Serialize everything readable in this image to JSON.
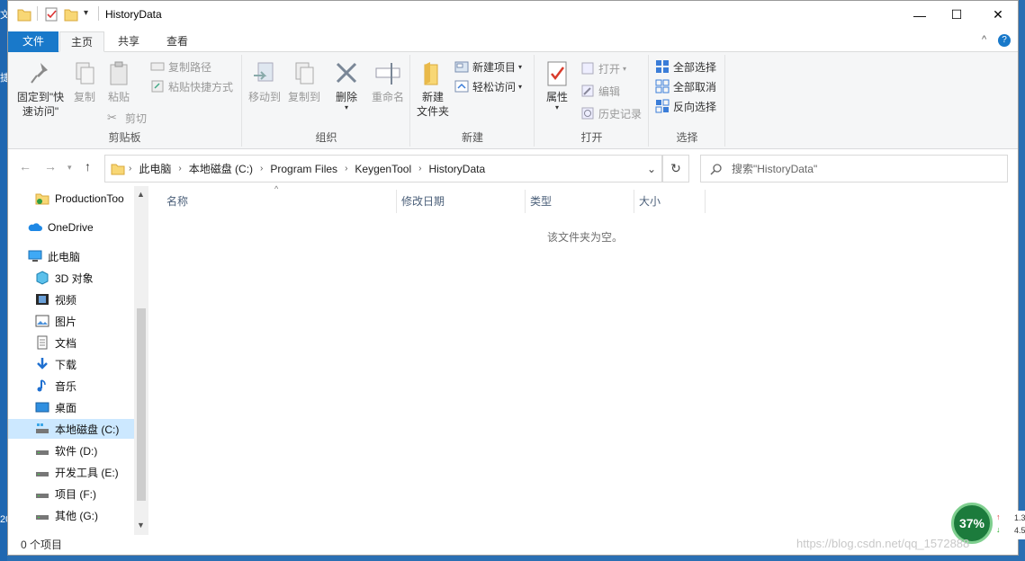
{
  "window": {
    "title": "HistoryData",
    "minimize": "—",
    "maximize": "☐",
    "close": "✕"
  },
  "desktop": {
    "left_char_top": "文",
    "left_char_mid": "捷",
    "left_char_low": "20"
  },
  "ribbon_tabs": [
    {
      "label": "文件"
    },
    {
      "label": "主页"
    },
    {
      "label": "共享"
    },
    {
      "label": "查看"
    }
  ],
  "tabs_right": {
    "collapse": "^",
    "help": "?"
  },
  "clipboard": {
    "label": "剪贴板",
    "pin": "固定到\"快速访问\"",
    "pin_line1": "固定到\"快",
    "pin_line2": "速访问\"",
    "copy": "复制",
    "paste": "粘贴",
    "copy_path": "复制路径",
    "paste_shortcut": "粘贴快捷方式",
    "cut": "剪切"
  },
  "organize": {
    "label": "组织",
    "move_to": "移动到",
    "copy_to": "复制到",
    "delete": "删除",
    "rename": "重命名"
  },
  "new_group": {
    "label": "新建",
    "new_item": "新建项目",
    "easy_access": "轻松访问",
    "new_folder_line1": "新建",
    "new_folder_line2": "文件夹"
  },
  "open_group": {
    "label": "打开",
    "properties": "属性",
    "open": "打开",
    "edit": "编辑",
    "history": "历史记录"
  },
  "select_group": {
    "label": "选择",
    "select_all": "全部选择",
    "select_none": "全部取消",
    "invert": "反向选择"
  },
  "address": {
    "crumbs": [
      "此电脑",
      "本地磁盘 (C:)",
      "Program Files",
      "KeygenTool",
      "HistoryData"
    ],
    "search_placeholder": "搜索\"HistoryData\""
  },
  "nav": {
    "items": [
      {
        "label": "ProductionToo"
      },
      {
        "label": "OneDrive"
      },
      {
        "label": "此电脑"
      },
      {
        "label": "3D 对象"
      },
      {
        "label": "视频"
      },
      {
        "label": "图片"
      },
      {
        "label": "文档"
      },
      {
        "label": "下载"
      },
      {
        "label": "音乐"
      },
      {
        "label": "桌面"
      },
      {
        "label": "本地磁盘 (C:)"
      },
      {
        "label": "软件 (D:)"
      },
      {
        "label": "开发工具 (E:)"
      },
      {
        "label": "项目 (F:)"
      },
      {
        "label": "其他 (G:)"
      }
    ]
  },
  "columns": {
    "name": "名称",
    "modified": "修改日期",
    "type": "类型",
    "size": "大小"
  },
  "empty_message": "该文件夹为空。",
  "status": {
    "item_count": "0 个项目"
  },
  "net_widget": {
    "percent": "37%",
    "up": "1.3",
    "down": "4.5"
  },
  "watermark": "https://blog.csdn.net/qq_1572888"
}
